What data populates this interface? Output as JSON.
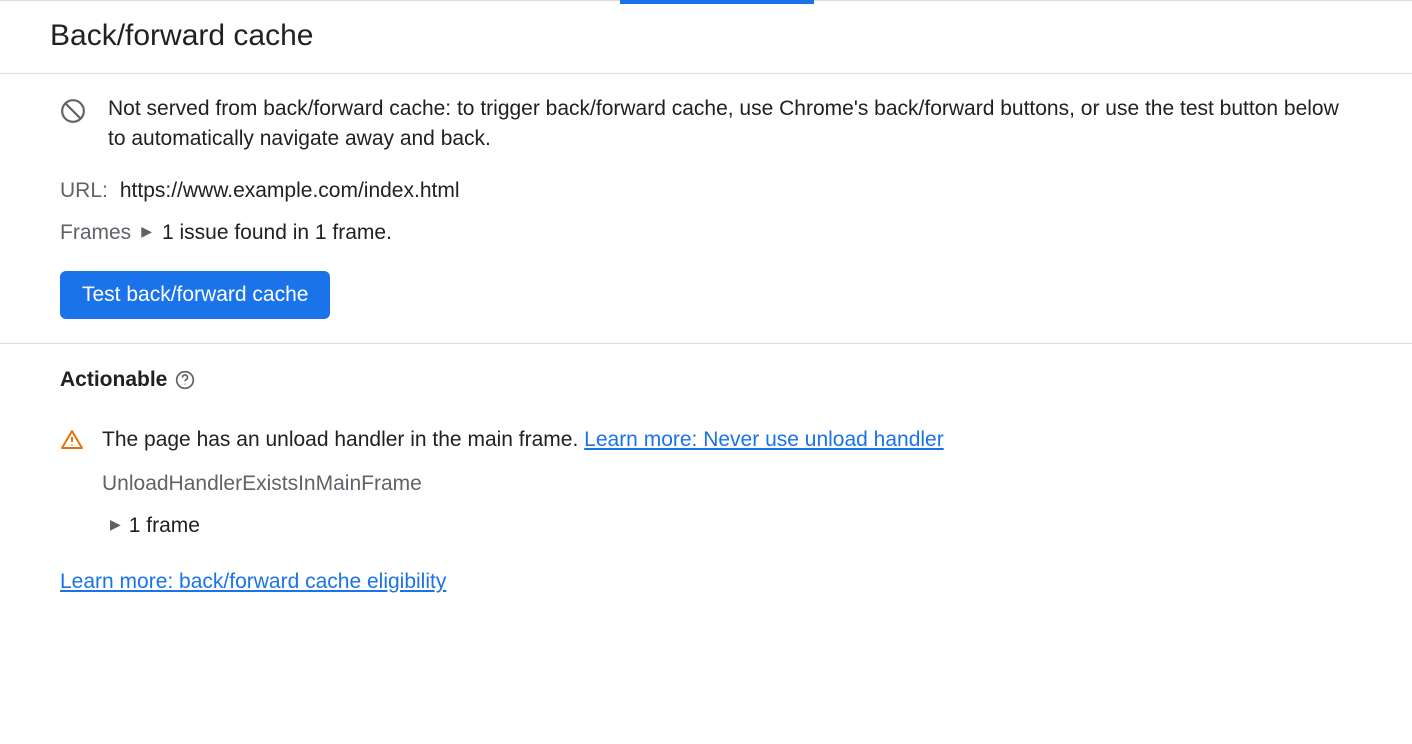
{
  "header": {
    "title": "Back/forward cache"
  },
  "notice": {
    "message": "Not served from back/forward cache: to trigger back/forward cache, use Chrome's back/forward buttons, or use the test button below to automatically navigate away and back."
  },
  "url": {
    "label": "URL:",
    "value": "https://www.example.com/index.html"
  },
  "frames": {
    "label": "Frames",
    "summary": "1 issue found in 1 frame."
  },
  "buttons": {
    "test_label": "Test back/forward cache"
  },
  "actionable": {
    "heading": "Actionable",
    "issue_message": "The page has an unload handler in the main frame. ",
    "issue_learn_more": "Learn more: Never use unload handler",
    "issue_code": "UnloadHandlerExistsInMainFrame",
    "issue_frame_count": "1 frame"
  },
  "bottom_link": "Learn more: back/forward cache eligibility"
}
